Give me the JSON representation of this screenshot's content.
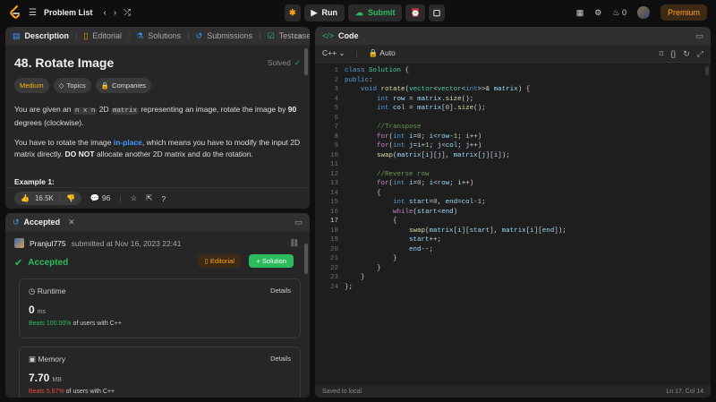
{
  "topbar": {
    "problem_list": "Problem List",
    "run": "Run",
    "submit": "Submit",
    "streak_count": "0",
    "premium": "Premium"
  },
  "description": {
    "tabs": [
      "Description",
      "Editorial",
      "Solutions",
      "Submissions",
      "Testcase"
    ],
    "title": "48. Rotate Image",
    "solved": "Solved",
    "tags": [
      "Medium",
      "Topics",
      "Companies"
    ],
    "p1_a": "You are given an ",
    "p1_code": "n x n",
    "p1_b": " 2D ",
    "p1_code2": "matrix",
    "p1_c": " representing an image, rotate the image by ",
    "p1_bold": "90",
    "p1_d": " degrees (clockwise).",
    "p2_a": "You have to rotate the image ",
    "p2_link": "in-place",
    "p2_b": ", which means you have to modify the input 2D matrix directly. ",
    "p2_bold": "DO NOT",
    "p2_c": " allocate another 2D matrix and do the rotation.",
    "example": "Example 1:",
    "likes": "16.5K",
    "comments": "96"
  },
  "accepted": {
    "tab": "Accepted",
    "user": "Pranjul775",
    "submitted": "submitted at Nov 16, 2023 22:41",
    "status": "Accepted",
    "editorial_btn": "Editorial",
    "solution_btn": "Solution",
    "runtime": {
      "label": "Runtime",
      "details": "Details",
      "value": "0",
      "unit": "ms",
      "beats": "Beats 100.00%",
      "rest": "of users with C++"
    },
    "memory": {
      "label": "Memory",
      "details": "Details",
      "value": "7.70",
      "unit": "MB",
      "beats": "Beats 5.67%",
      "rest": "of users with C++"
    }
  },
  "code": {
    "tab": "Code",
    "language": "C++",
    "auto": "Auto",
    "saved": "Saved to local",
    "cursor": "Ln 17, Col 14",
    "line_numbers": [
      "1",
      "2",
      "3",
      "4",
      "5",
      "6",
      "7",
      "8",
      "9",
      "10",
      "11",
      "12",
      "13",
      "14",
      "15",
      "16",
      "17",
      "18",
      "19",
      "20",
      "21",
      "22",
      "23",
      "24"
    ]
  }
}
